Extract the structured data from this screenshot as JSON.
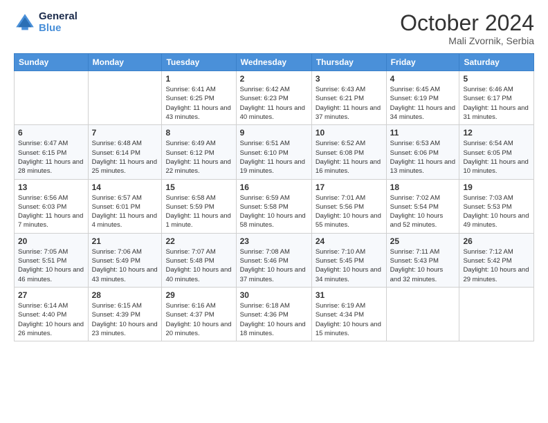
{
  "logo": {
    "line1": "General",
    "line2": "Blue",
    "icon_color": "#4a90d9"
  },
  "title": {
    "month_year": "October 2024",
    "location": "Mali Zvornik, Serbia"
  },
  "weekdays": [
    "Sunday",
    "Monday",
    "Tuesday",
    "Wednesday",
    "Thursday",
    "Friday",
    "Saturday"
  ],
  "weeks": [
    [
      {
        "day": "",
        "sunrise": "",
        "sunset": "",
        "daylight": ""
      },
      {
        "day": "",
        "sunrise": "",
        "sunset": "",
        "daylight": ""
      },
      {
        "day": "1",
        "sunrise": "Sunrise: 6:41 AM",
        "sunset": "Sunset: 6:25 PM",
        "daylight": "Daylight: 11 hours and 43 minutes."
      },
      {
        "day": "2",
        "sunrise": "Sunrise: 6:42 AM",
        "sunset": "Sunset: 6:23 PM",
        "daylight": "Daylight: 11 hours and 40 minutes."
      },
      {
        "day": "3",
        "sunrise": "Sunrise: 6:43 AM",
        "sunset": "Sunset: 6:21 PM",
        "daylight": "Daylight: 11 hours and 37 minutes."
      },
      {
        "day": "4",
        "sunrise": "Sunrise: 6:45 AM",
        "sunset": "Sunset: 6:19 PM",
        "daylight": "Daylight: 11 hours and 34 minutes."
      },
      {
        "day": "5",
        "sunrise": "Sunrise: 6:46 AM",
        "sunset": "Sunset: 6:17 PM",
        "daylight": "Daylight: 11 hours and 31 minutes."
      }
    ],
    [
      {
        "day": "6",
        "sunrise": "Sunrise: 6:47 AM",
        "sunset": "Sunset: 6:15 PM",
        "daylight": "Daylight: 11 hours and 28 minutes."
      },
      {
        "day": "7",
        "sunrise": "Sunrise: 6:48 AM",
        "sunset": "Sunset: 6:14 PM",
        "daylight": "Daylight: 11 hours and 25 minutes."
      },
      {
        "day": "8",
        "sunrise": "Sunrise: 6:49 AM",
        "sunset": "Sunset: 6:12 PM",
        "daylight": "Daylight: 11 hours and 22 minutes."
      },
      {
        "day": "9",
        "sunrise": "Sunrise: 6:51 AM",
        "sunset": "Sunset: 6:10 PM",
        "daylight": "Daylight: 11 hours and 19 minutes."
      },
      {
        "day": "10",
        "sunrise": "Sunrise: 6:52 AM",
        "sunset": "Sunset: 6:08 PM",
        "daylight": "Daylight: 11 hours and 16 minutes."
      },
      {
        "day": "11",
        "sunrise": "Sunrise: 6:53 AM",
        "sunset": "Sunset: 6:06 PM",
        "daylight": "Daylight: 11 hours and 13 minutes."
      },
      {
        "day": "12",
        "sunrise": "Sunrise: 6:54 AM",
        "sunset": "Sunset: 6:05 PM",
        "daylight": "Daylight: 11 hours and 10 minutes."
      }
    ],
    [
      {
        "day": "13",
        "sunrise": "Sunrise: 6:56 AM",
        "sunset": "Sunset: 6:03 PM",
        "daylight": "Daylight: 11 hours and 7 minutes."
      },
      {
        "day": "14",
        "sunrise": "Sunrise: 6:57 AM",
        "sunset": "Sunset: 6:01 PM",
        "daylight": "Daylight: 11 hours and 4 minutes."
      },
      {
        "day": "15",
        "sunrise": "Sunrise: 6:58 AM",
        "sunset": "Sunset: 5:59 PM",
        "daylight": "Daylight: 11 hours and 1 minute."
      },
      {
        "day": "16",
        "sunrise": "Sunrise: 6:59 AM",
        "sunset": "Sunset: 5:58 PM",
        "daylight": "Daylight: 10 hours and 58 minutes."
      },
      {
        "day": "17",
        "sunrise": "Sunrise: 7:01 AM",
        "sunset": "Sunset: 5:56 PM",
        "daylight": "Daylight: 10 hours and 55 minutes."
      },
      {
        "day": "18",
        "sunrise": "Sunrise: 7:02 AM",
        "sunset": "Sunset: 5:54 PM",
        "daylight": "Daylight: 10 hours and 52 minutes."
      },
      {
        "day": "19",
        "sunrise": "Sunrise: 7:03 AM",
        "sunset": "Sunset: 5:53 PM",
        "daylight": "Daylight: 10 hours and 49 minutes."
      }
    ],
    [
      {
        "day": "20",
        "sunrise": "Sunrise: 7:05 AM",
        "sunset": "Sunset: 5:51 PM",
        "daylight": "Daylight: 10 hours and 46 minutes."
      },
      {
        "day": "21",
        "sunrise": "Sunrise: 7:06 AM",
        "sunset": "Sunset: 5:49 PM",
        "daylight": "Daylight: 10 hours and 43 minutes."
      },
      {
        "day": "22",
        "sunrise": "Sunrise: 7:07 AM",
        "sunset": "Sunset: 5:48 PM",
        "daylight": "Daylight: 10 hours and 40 minutes."
      },
      {
        "day": "23",
        "sunrise": "Sunrise: 7:08 AM",
        "sunset": "Sunset: 5:46 PM",
        "daylight": "Daylight: 10 hours and 37 minutes."
      },
      {
        "day": "24",
        "sunrise": "Sunrise: 7:10 AM",
        "sunset": "Sunset: 5:45 PM",
        "daylight": "Daylight: 10 hours and 34 minutes."
      },
      {
        "day": "25",
        "sunrise": "Sunrise: 7:11 AM",
        "sunset": "Sunset: 5:43 PM",
        "daylight": "Daylight: 10 hours and 32 minutes."
      },
      {
        "day": "26",
        "sunrise": "Sunrise: 7:12 AM",
        "sunset": "Sunset: 5:42 PM",
        "daylight": "Daylight: 10 hours and 29 minutes."
      }
    ],
    [
      {
        "day": "27",
        "sunrise": "Sunrise: 6:14 AM",
        "sunset": "Sunset: 4:40 PM",
        "daylight": "Daylight: 10 hours and 26 minutes."
      },
      {
        "day": "28",
        "sunrise": "Sunrise: 6:15 AM",
        "sunset": "Sunset: 4:39 PM",
        "daylight": "Daylight: 10 hours and 23 minutes."
      },
      {
        "day": "29",
        "sunrise": "Sunrise: 6:16 AM",
        "sunset": "Sunset: 4:37 PM",
        "daylight": "Daylight: 10 hours and 20 minutes."
      },
      {
        "day": "30",
        "sunrise": "Sunrise: 6:18 AM",
        "sunset": "Sunset: 4:36 PM",
        "daylight": "Daylight: 10 hours and 18 minutes."
      },
      {
        "day": "31",
        "sunrise": "Sunrise: 6:19 AM",
        "sunset": "Sunset: 4:34 PM",
        "daylight": "Daylight: 10 hours and 15 minutes."
      },
      {
        "day": "",
        "sunrise": "",
        "sunset": "",
        "daylight": ""
      },
      {
        "day": "",
        "sunrise": "",
        "sunset": "",
        "daylight": ""
      }
    ]
  ]
}
